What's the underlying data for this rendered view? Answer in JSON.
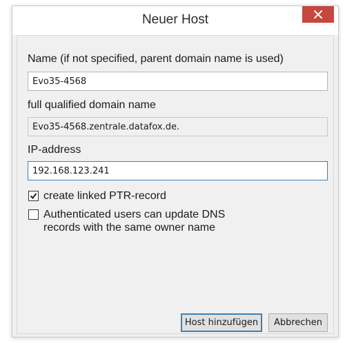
{
  "dialog": {
    "title": "Neuer Host",
    "close_icon": "close-icon"
  },
  "name_field": {
    "label": "Name (if not specified, parent domain name is used)",
    "value": "Evo35-4568"
  },
  "fqdn_field": {
    "label": "full qualified domain name",
    "value": "Evo35-4568.zentrale.datafox.de."
  },
  "ip_field": {
    "label": "IP-address",
    "value": "192.168.123.241"
  },
  "options": {
    "ptr_record": {
      "label": "create linked PTR-record",
      "checked": true
    },
    "auth_update": {
      "label_line1": "Authenticated users can update DNS",
      "label_line2": "records with the same owner name",
      "checked": false
    }
  },
  "buttons": {
    "add_host": "Host hinzufügen",
    "cancel": "Abbrechen"
  },
  "colors": {
    "close_button": "#c7463e",
    "focus_border": "#3c7fb1",
    "dialog_bg": "#f0f0f0"
  }
}
